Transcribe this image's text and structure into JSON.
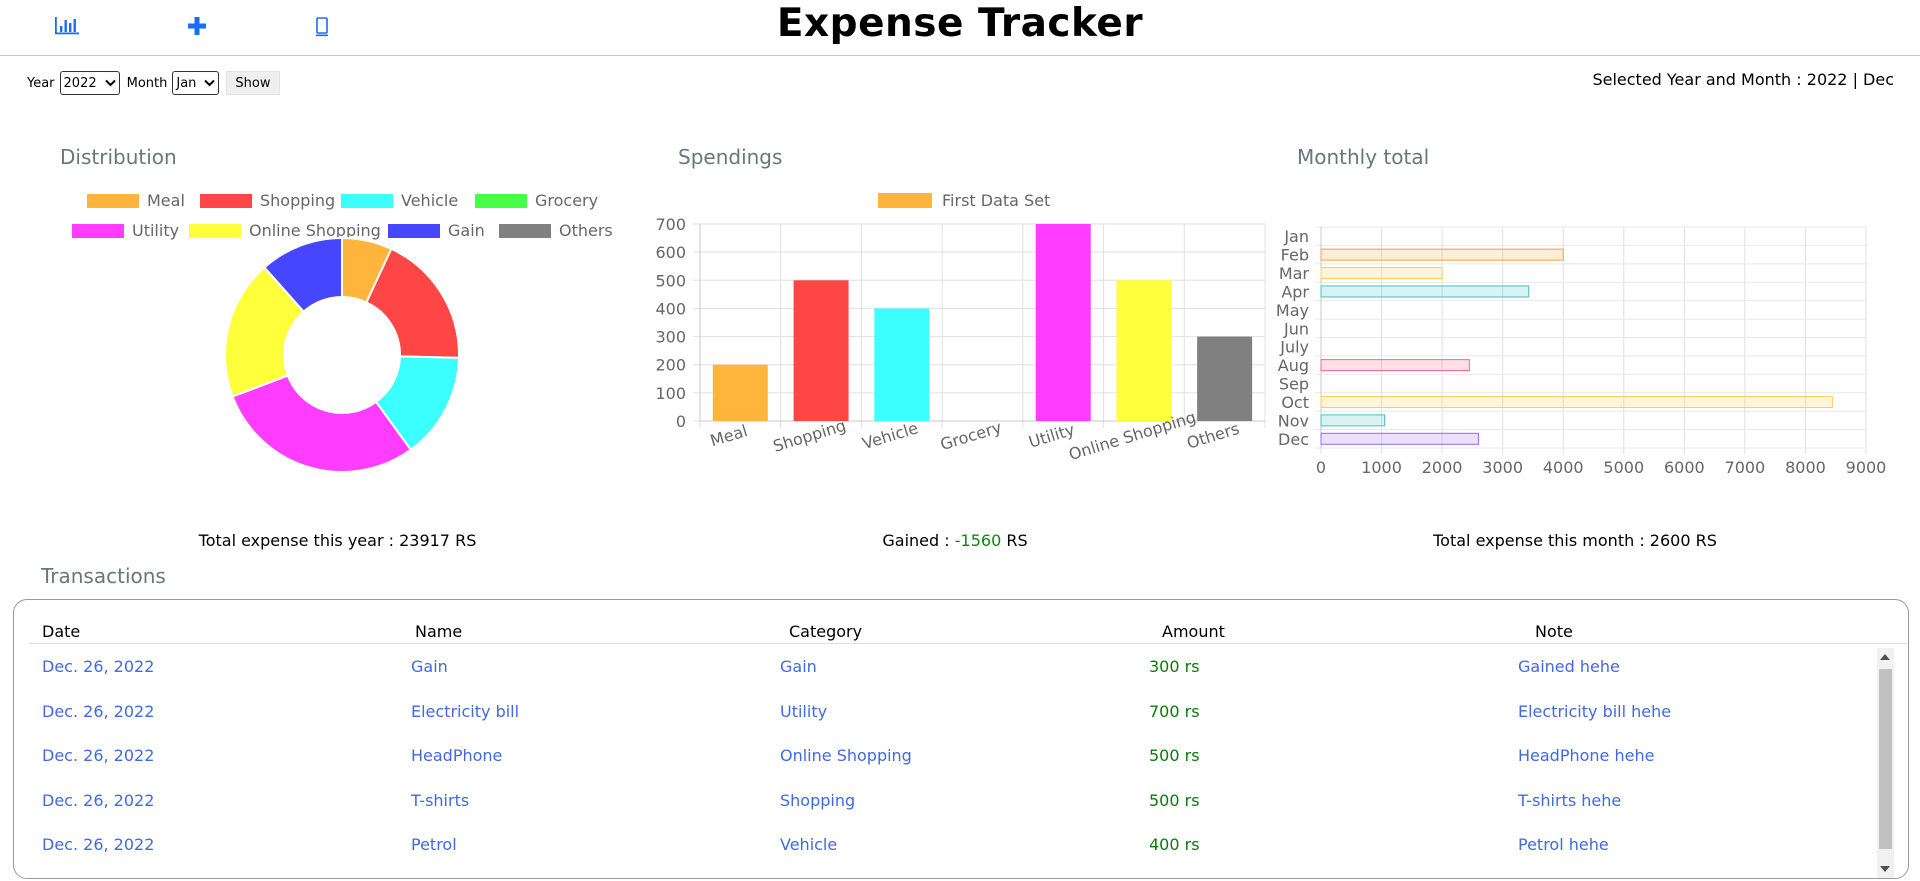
{
  "header": {
    "title": "Expense Tracker",
    "nav": [
      {
        "icon": "bar-chart-icon"
      },
      {
        "icon": "plus-icon"
      },
      {
        "icon": "mobile-icon"
      }
    ]
  },
  "filters": {
    "year_label": "Year",
    "year_value": "2022",
    "month_label": "Month",
    "month_value": "Jan",
    "show_label": "Show"
  },
  "selected": "Selected Year and Month : 2022 | Dec",
  "cards": {
    "distribution_title": "Distribution",
    "spendings_title": "Spendings",
    "monthly_title": "Monthly total"
  },
  "summaries": {
    "year_total": "Total expense this year : 23917 RS",
    "gained_label": "Gained : ",
    "gained_value": "-1560",
    "gained_unit": " RS",
    "month_total": "Total expense this month : 2600 RS"
  },
  "colors": {
    "Meal": "#ffb53c",
    "Shopping": "#ff4646",
    "Vehicle": "#3cffff",
    "Grocery": "#46ff46",
    "Utility": "#ff3cff",
    "Online Shopping": "#ffff3c",
    "Gain": "#4646ff",
    "Others": "#808080"
  },
  "chart_data": [
    {
      "type": "pie",
      "title": "Distribution",
      "categories": [
        "Meal",
        "Shopping",
        "Vehicle",
        "Grocery",
        "Utility",
        "Online Shopping",
        "Gain",
        "Others"
      ],
      "values": [
        1800,
        4800,
        3800,
        0,
        7600,
        5000,
        3000,
        0
      ],
      "legend": "top"
    },
    {
      "type": "bar",
      "title": "Spendings",
      "categories": [
        "Meal",
        "Shopping",
        "Vehicle",
        "Grocery",
        "Utility",
        "Online Shopping",
        "Others"
      ],
      "series": [
        {
          "name": "First Data Set",
          "values": [
            200,
            500,
            400,
            0,
            700,
            500,
            300
          ]
        }
      ],
      "ylim": [
        0,
        700
      ],
      "yticks": [
        0,
        100,
        200,
        300,
        400,
        500,
        600,
        700
      ],
      "grid": true,
      "legend": "top"
    },
    {
      "type": "bar",
      "orientation": "horizontal",
      "title": "Monthly total",
      "categories": [
        "Jan",
        "Feb",
        "Mar",
        "Apr",
        "May",
        "Jun",
        "July",
        "Aug",
        "Sep",
        "Oct",
        "Nov",
        "Dec"
      ],
      "values": [
        0,
        4000,
        2000,
        3430,
        0,
        0,
        0,
        2450,
        0,
        8450,
        1050,
        2600
      ],
      "colors": [
        "#ff6384",
        "#ff9f40",
        "#ffcd56",
        "#4bc0c0",
        "#36a2eb",
        "#9966ff",
        "#c9cbcf",
        "#ff6384",
        "#ff9f40",
        "#ffcd56",
        "#4bc0c0",
        "#9966ff"
      ],
      "xlim": [
        0,
        9000
      ],
      "xticks": [
        0,
        1000,
        2000,
        3000,
        4000,
        5000,
        6000,
        7000,
        8000,
        9000
      ],
      "grid": true
    }
  ],
  "transactions": {
    "title": "Transactions",
    "columns": [
      "Date",
      "Name",
      "Category",
      "Amount",
      "Note"
    ],
    "rows": [
      [
        "Dec. 26, 2022",
        "Gain",
        "Gain",
        "300 rs",
        "Gained hehe"
      ],
      [
        "Dec. 26, 2022",
        "Electricity bill",
        "Utility",
        "700 rs",
        "Electricity bill hehe"
      ],
      [
        "Dec. 26, 2022",
        "HeadPhone",
        "Online Shopping",
        "500 rs",
        "HeadPhone hehe"
      ],
      [
        "Dec. 26, 2022",
        "T-shirts",
        "Shopping",
        "500 rs",
        "T-shirts hehe"
      ],
      [
        "Dec. 26, 2022",
        "Petrol",
        "Vehicle",
        "400 rs",
        "Petrol hehe"
      ]
    ]
  }
}
